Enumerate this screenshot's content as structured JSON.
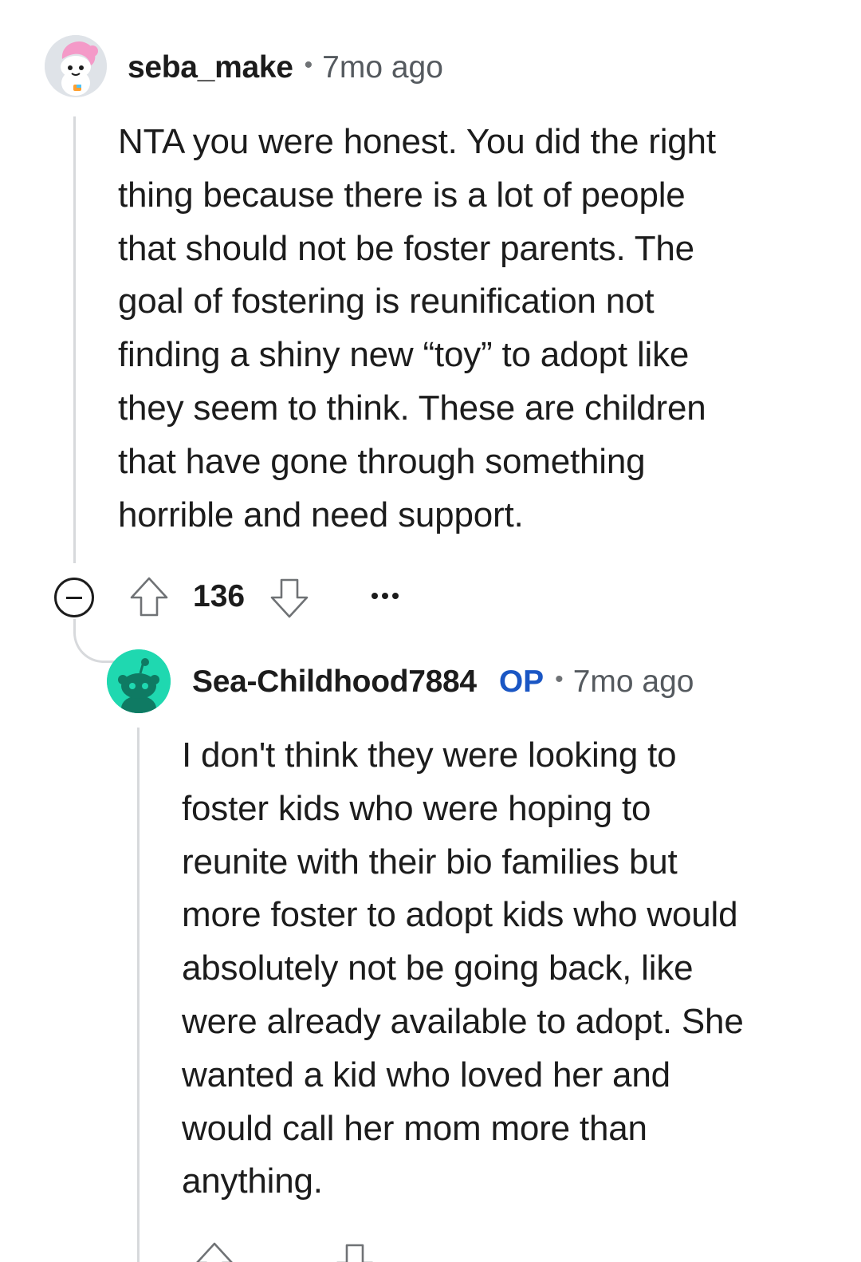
{
  "comments": [
    {
      "username": "seba_make",
      "separator": "•",
      "timestamp": "7mo ago",
      "avatar_icon": "snoo-avatar-pink-hair-icon",
      "body": [
        "NTA you were honest. You did the right",
        "thing because there is a lot of people",
        "that should not be foster parents. The",
        "goal of fostering is reunification not",
        "finding a shiny new “toy” to adopt like",
        "they seem to think. These are children",
        "that have gone through something",
        "horrible and need support."
      ],
      "score": "136",
      "actions": {
        "collapse_icon": "collapse-minus-icon",
        "upvote_icon": "upvote-arrow-icon",
        "downvote_icon": "downvote-arrow-icon",
        "more_icon": "more-options-icon"
      }
    },
    {
      "username": "Sea-Childhood7884",
      "badge": "OP",
      "separator": "•",
      "timestamp": "7mo ago",
      "avatar_icon": "snoo-avatar-default-green-icon",
      "body": [
        "I don't think they were looking to",
        "foster kids who were hoping to",
        "reunite with their bio families but",
        "more foster to adopt kids who would",
        "absolutely not be going back, like",
        "were already available to adopt. She",
        "wanted a kid who loved her and",
        "would call her mom more than",
        "anything."
      ]
    }
  ],
  "colors": {
    "text": "#1c1c1c",
    "meta": "#555a5f",
    "op_badge": "#1a56c4",
    "thread_line": "#d7d9dc",
    "avatar2_bg": "#1fd8b0"
  }
}
